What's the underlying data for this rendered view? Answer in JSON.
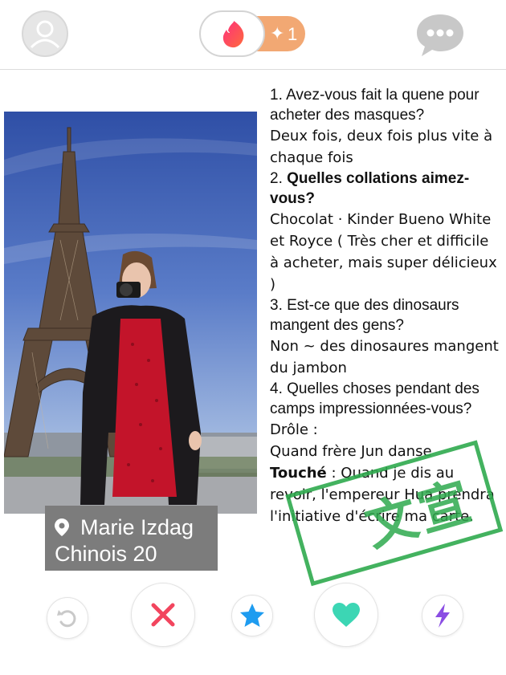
{
  "profile": {
    "name": "Marie Izdag",
    "subtitle": "Chinois 20"
  },
  "topbar": {
    "boost_count": "1",
    "boost_spark": "✦"
  },
  "qa": {
    "q1": "1. Avez-vous fait la quene pour acheter des masques?",
    "a1": "Deux fois, deux fois plus vite à chaque fois",
    "q2_num": "2. ",
    "q2_text": "Quelles collations aimez-vous?",
    "a2": "Chocolat · Kinder Bueno White et Royce ( Très cher et difficile à acheter, mais super délicieux )",
    "q3": "3. Est-ce que des dinosaurs mangent des gens?",
    "a3": "Non ~ des dinosaures mangent du jambon",
    "q4": "4. Quelles choses pendant des camps impressionnées-vous?",
    "a4_label": "Drôle  :",
    "a4_line": "Quand frère Jun danse",
    "a4_touched_label": "Touché",
    "a4_touched_text": " : Quand je dis au revoir, l'empereur Hua prendra l'initiative d'écrire ma carte."
  },
  "stamp": {
    "text": "文宣"
  },
  "colors": {
    "tinder_flame": "#fd5068",
    "boost_orange": "#f2a873",
    "nope_red": "#f2455e",
    "super_blue": "#1e9cf0",
    "like_teal": "#3cd6b4",
    "boost_purple": "#8a4de3",
    "stamp_green": "#2faa4e"
  },
  "icons": {
    "avatar": "user-avatar-icon",
    "logo": "tinder-flame-icon",
    "chat": "chat-bubble-icon",
    "rewind": "rewind-icon",
    "nope": "close-x-icon",
    "super_like": "star-icon",
    "like": "heart-icon",
    "boost": "lightning-bolt-icon",
    "pin": "location-pin-icon"
  }
}
